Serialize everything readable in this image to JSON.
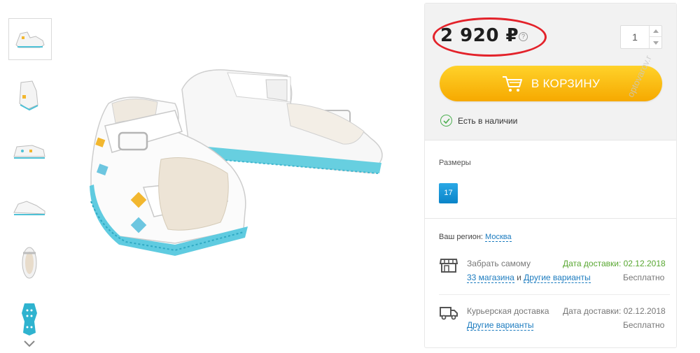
{
  "product": {
    "price": "2 920 ₽",
    "quantity": "1",
    "cart_button_label": "В КОРЗИНУ",
    "stock_status": "Есть в наличии"
  },
  "sizes": {
    "title": "Размеры",
    "options": [
      "17"
    ]
  },
  "delivery": {
    "region_label": "Ваш регион:",
    "region_value": "Москва",
    "pickup": {
      "name": "Забрать самому",
      "date_label": "Дата доставки: 02.12.2018",
      "stores_link": "33 магазина",
      "and_text": "и",
      "other_link": "Другие варианты",
      "price": "Бесплатно"
    },
    "courier": {
      "name": "Курьерская доставка",
      "date_label": "Дата доставки: 02.12.2018",
      "other_link": "Другие варианты",
      "price": "Бесплатно"
    }
  },
  "watermark": "optovarov.r",
  "colors": {
    "cart_button": "#f9c10a",
    "price_highlight": "#e3222a",
    "link": "#1b7bbf",
    "stock_ok": "#4caf50",
    "size_chip": "#1a96d6",
    "pickup_date": "#58a731"
  },
  "icons": [
    "help-icon",
    "cart-icon",
    "check-circle-icon",
    "store-icon",
    "truck-icon",
    "chevron-down-icon"
  ]
}
